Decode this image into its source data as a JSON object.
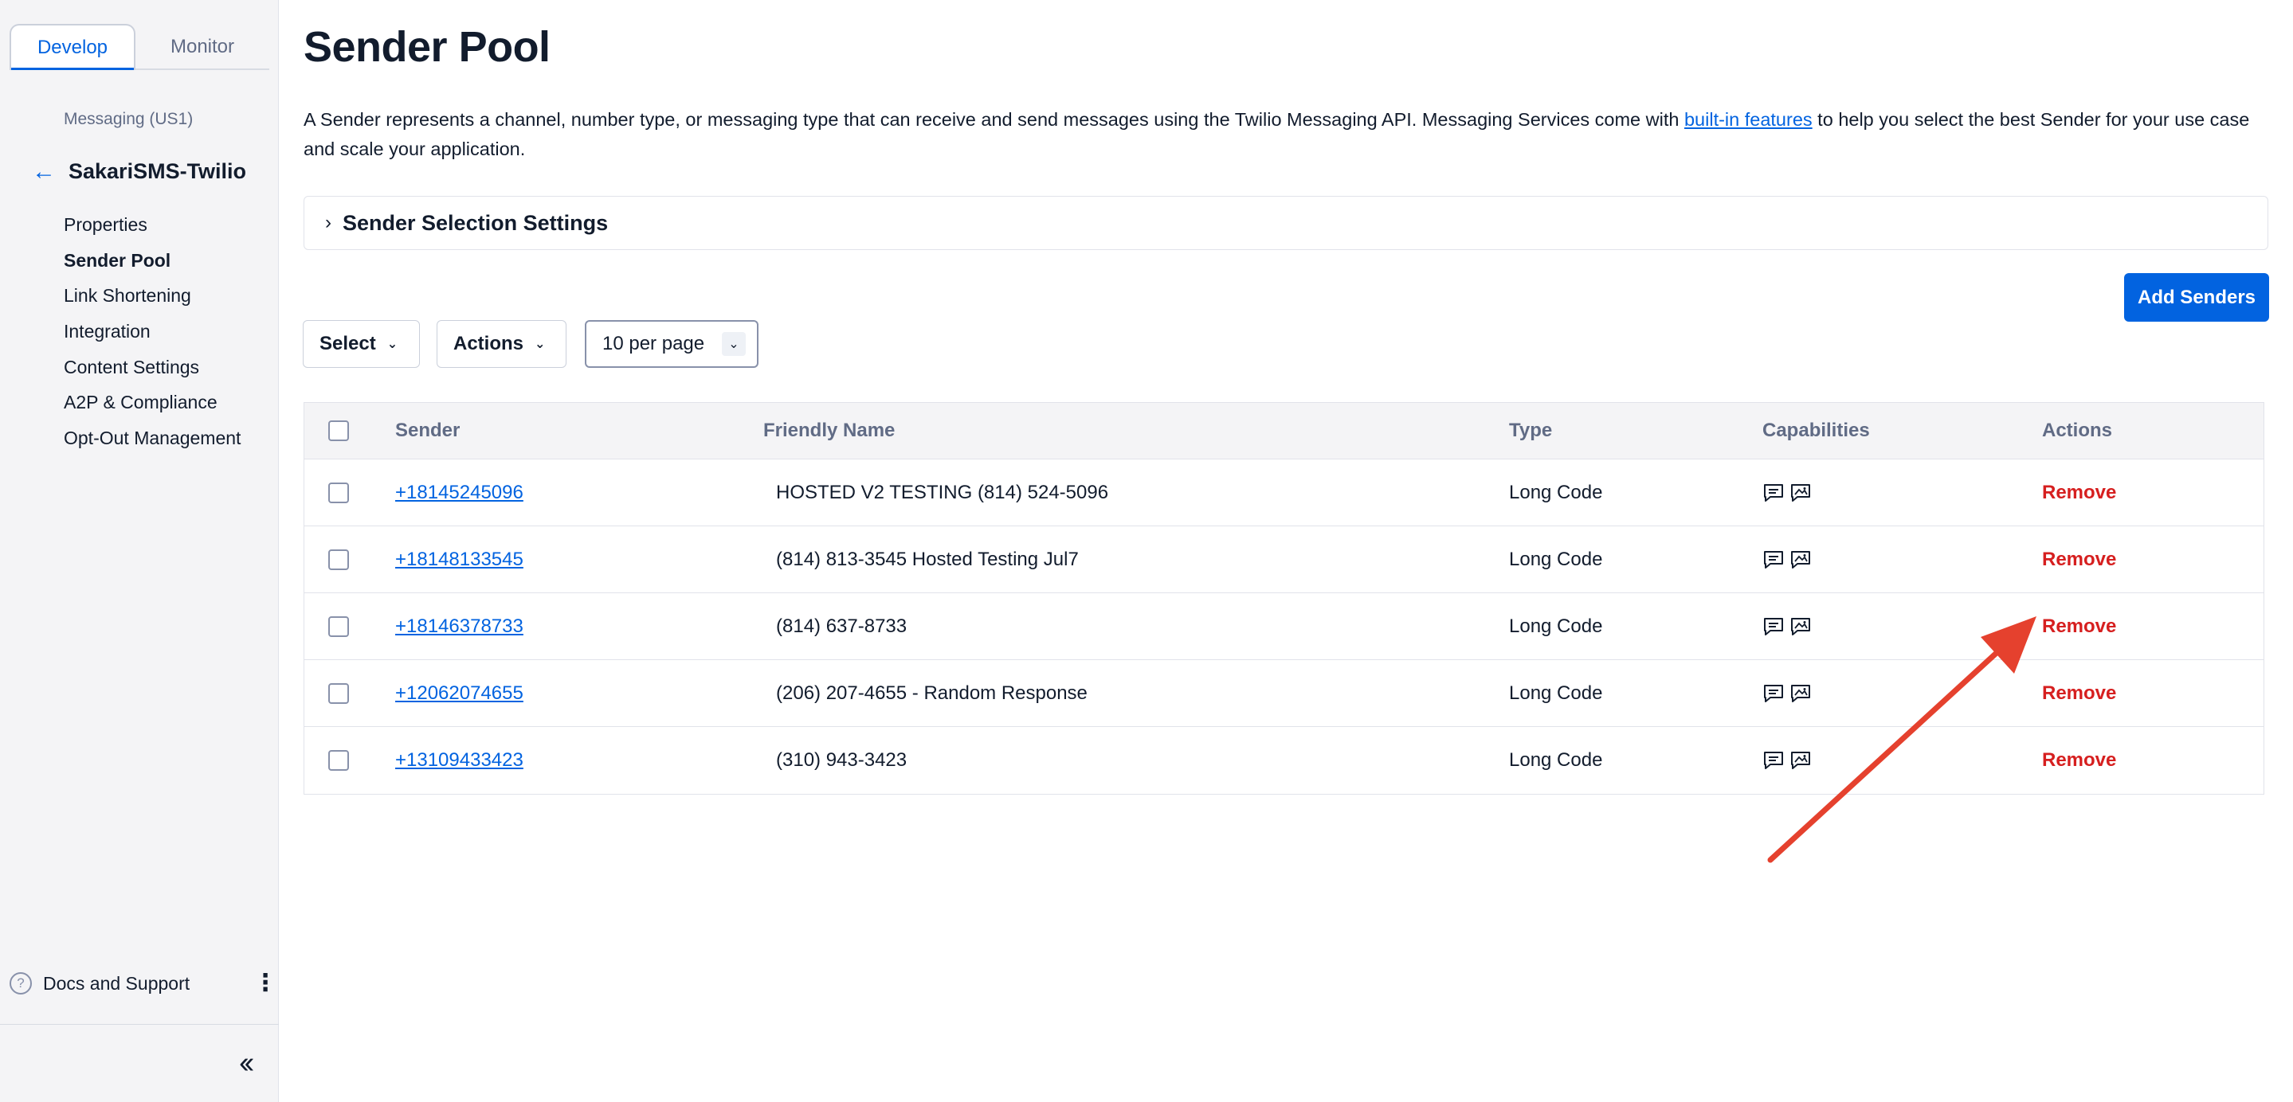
{
  "sidebar": {
    "tabs": [
      {
        "label": "Develop",
        "active": true
      },
      {
        "label": "Monitor",
        "active": false
      }
    ],
    "breadcrumb": "Messaging (US1)",
    "service_name": "SakariSMS-Twilio",
    "nav": [
      {
        "label": "Properties",
        "active": false
      },
      {
        "label": "Sender Pool",
        "active": true
      },
      {
        "label": "Link Shortening",
        "active": false
      },
      {
        "label": "Integration",
        "active": false
      },
      {
        "label": "Content Settings",
        "active": false
      },
      {
        "label": "A2P & Compliance",
        "active": false
      },
      {
        "label": "Opt-Out Management",
        "active": false
      }
    ],
    "docs_label": "Docs and Support"
  },
  "main": {
    "title": "Sender Pool",
    "description_pre": "A Sender represents a channel, number type, or messaging type that can receive and send messages using the Twilio Messaging API. Messaging Services come with ",
    "description_link": "built-in features",
    "description_post": " to help you select the best Sender for your use case and scale your application.",
    "disclosure_label": "Sender Selection Settings",
    "add_button": "Add Senders",
    "select_label": "Select",
    "actions_label": "Actions",
    "per_page": "10 per page"
  },
  "table": {
    "headers": {
      "sender": "Sender",
      "friendly": "Friendly Name",
      "type": "Type",
      "capabilities": "Capabilities",
      "actions": "Actions"
    },
    "rows": [
      {
        "sender": "+18145245096",
        "friendly": "HOSTED V2 TESTING (814) 524-5096",
        "type": "Long Code",
        "action": "Remove"
      },
      {
        "sender": "+18148133545",
        "friendly": "(814) 813-3545 Hosted Testing Jul7",
        "type": "Long Code",
        "action": "Remove"
      },
      {
        "sender": "+18146378733",
        "friendly": "(814) 637-8733",
        "type": "Long Code",
        "action": "Remove"
      },
      {
        "sender": "+12062074655",
        "friendly": "(206) 207-4655 - Random Response",
        "type": "Long Code",
        "action": "Remove"
      },
      {
        "sender": "+13109433423",
        "friendly": "(310) 943-3423",
        "type": "Long Code",
        "action": "Remove"
      }
    ]
  },
  "colors": {
    "accent": "#0263e0",
    "remove": "#d61f1f",
    "annotation_arrow": "#e5412e"
  },
  "icons": {
    "sms_capability": "sms-icon",
    "mms_capability": "mms-icon"
  }
}
